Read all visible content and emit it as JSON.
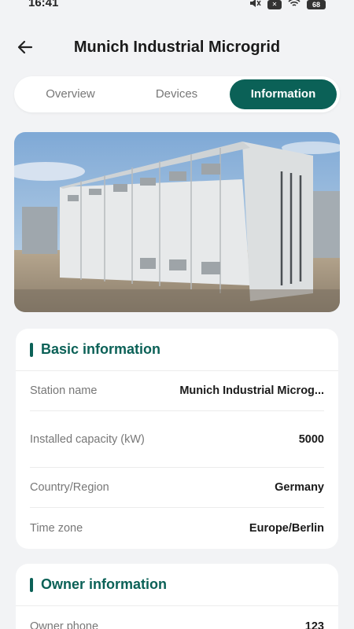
{
  "status": {
    "time": "16:41",
    "battery": "68",
    "icons": [
      "mute-icon",
      "close-box-icon",
      "wifi-icon",
      "battery-icon"
    ]
  },
  "header": {
    "title": "Munich Industrial Microgrid",
    "back_icon": "arrow-left-icon"
  },
  "tabs": [
    {
      "label": "Overview",
      "active": false
    },
    {
      "label": "Devices",
      "active": false
    },
    {
      "label": "Information",
      "active": true
    }
  ],
  "hero": {
    "image": "battery-storage-containers-photo"
  },
  "basic": {
    "title": "Basic information",
    "rows": [
      {
        "label": "Station name",
        "value": "Munich Industrial Microg..."
      },
      {
        "label": "Installed capacity (kW)",
        "value": "5000"
      },
      {
        "label": "Country/Region",
        "value": "Germany"
      },
      {
        "label": "Time zone",
        "value": "Europe/Berlin"
      }
    ]
  },
  "owner": {
    "title": "Owner information",
    "rows": [
      {
        "label": "Owner phone",
        "value": "123"
      }
    ]
  },
  "colors": {
    "accent": "#0b6157",
    "background": "#f2f3f5"
  }
}
